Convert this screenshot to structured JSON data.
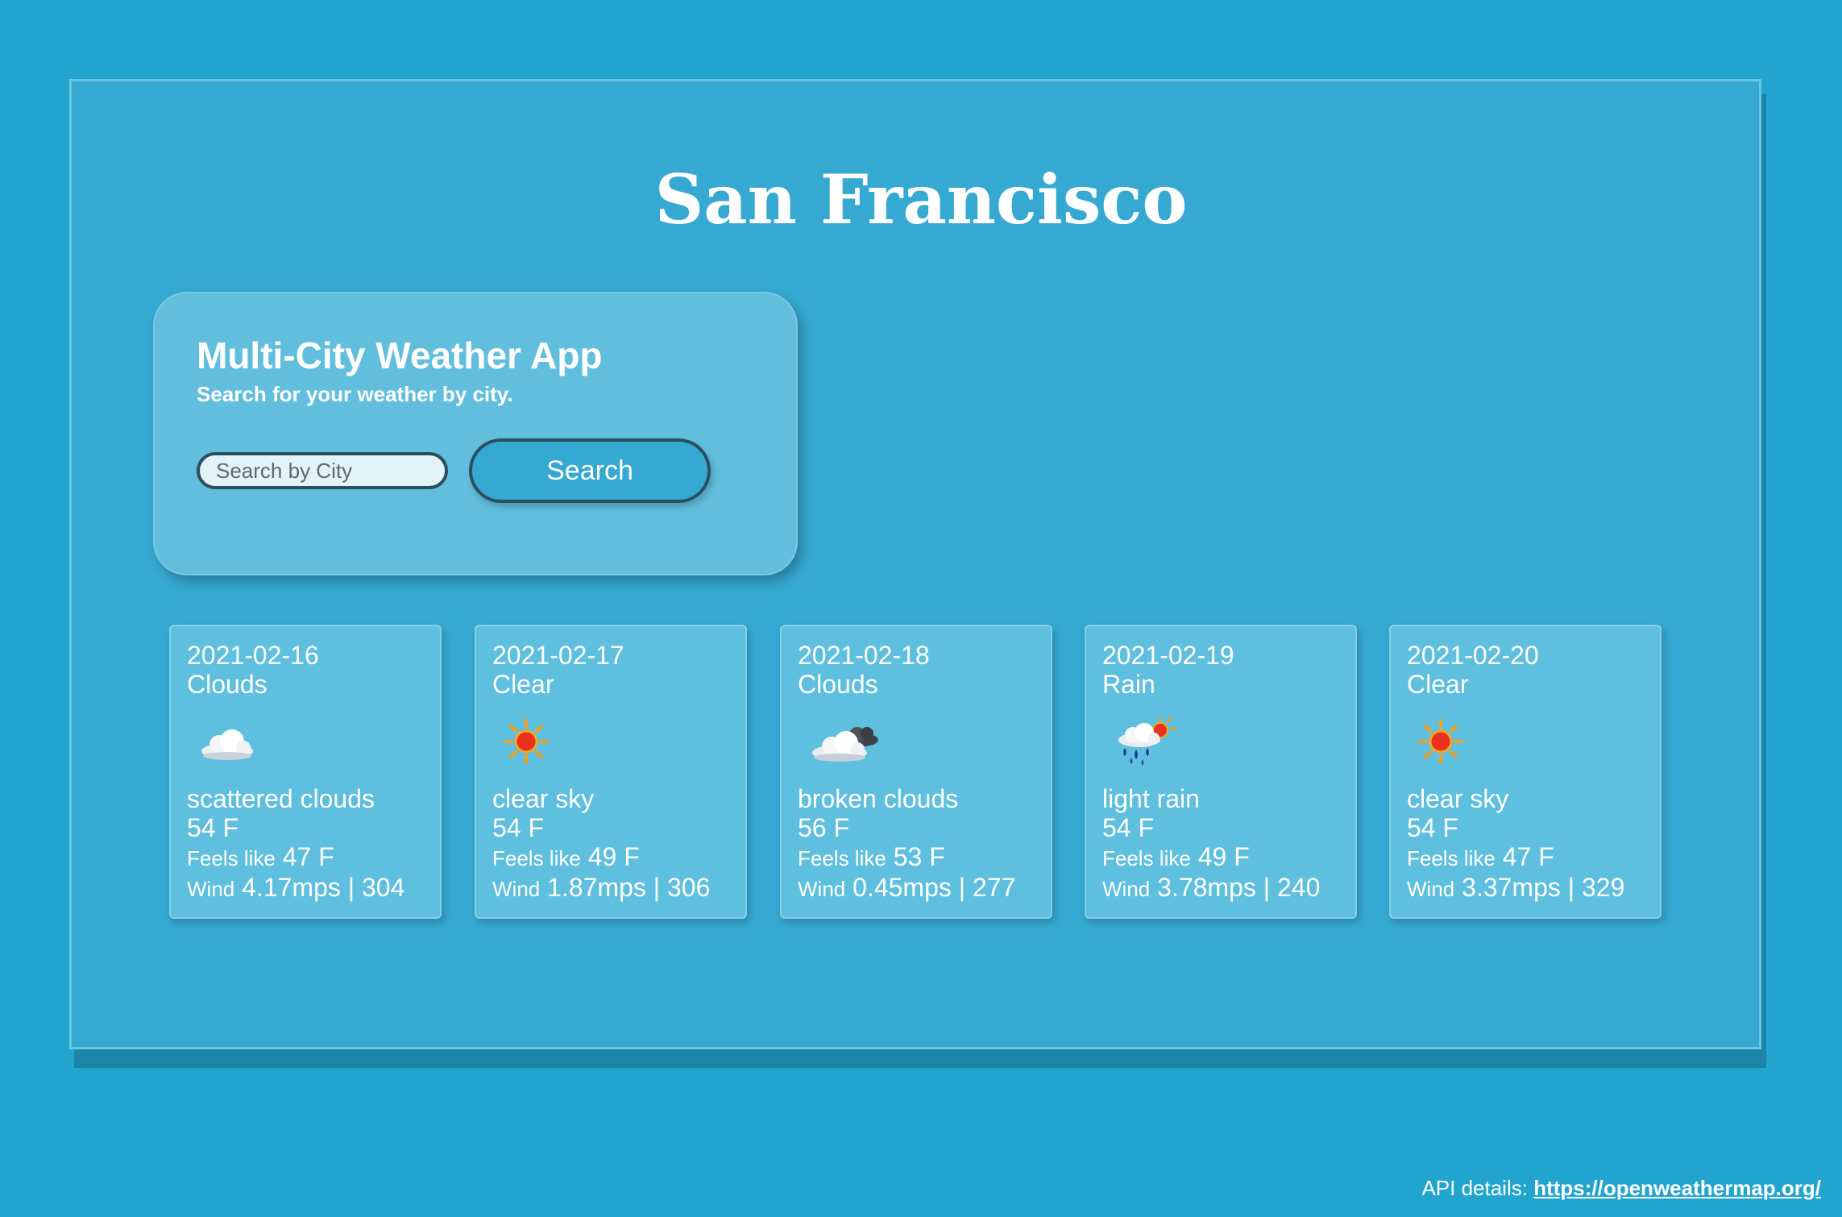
{
  "header": {
    "city": "San Francisco"
  },
  "search_panel": {
    "title": "Multi-City Weather App",
    "subtitle": "Search for your weather by city.",
    "input_placeholder": "Search by City",
    "button_label": "Search"
  },
  "forecast": [
    {
      "date": "2021-02-16",
      "condition": "Clouds",
      "icon": "scattered-clouds-icon",
      "description": "scattered clouds",
      "temp": "54 F",
      "feels_label": "Feels like",
      "feels_value": "47 F",
      "wind_label": "Wind",
      "wind_value": "4.17mps | 304"
    },
    {
      "date": "2021-02-17",
      "condition": "Clear",
      "icon": "clear-sky-icon",
      "description": "clear sky",
      "temp": "54 F",
      "feels_label": "Feels like",
      "feels_value": "49 F",
      "wind_label": "Wind",
      "wind_value": "1.87mps | 306"
    },
    {
      "date": "2021-02-18",
      "condition": "Clouds",
      "icon": "broken-clouds-icon",
      "description": "broken clouds",
      "temp": "56 F",
      "feels_label": "Feels like",
      "feels_value": "53 F",
      "wind_label": "Wind",
      "wind_value": "0.45mps | 277"
    },
    {
      "date": "2021-02-19",
      "condition": "Rain",
      "icon": "light-rain-icon",
      "description": "light rain",
      "temp": "54 F",
      "feels_label": "Feels like",
      "feels_value": "49 F",
      "wind_label": "Wind",
      "wind_value": "3.78mps | 240"
    },
    {
      "date": "2021-02-20",
      "condition": "Clear",
      "icon": "clear-sky-icon",
      "description": "clear sky",
      "temp": "54 F",
      "feels_label": "Feels like",
      "feels_value": "47 F",
      "wind_label": "Wind",
      "wind_value": "3.37mps | 329"
    }
  ],
  "footer": {
    "label": "API details:",
    "link_text": "https://openweathermap.org/"
  },
  "colors": {
    "page_background": "#21a5ce",
    "frame_background": "#36a9d2",
    "card_background": "#5fbfde",
    "input_border": "#2c4f5e",
    "sun": "#e8321e"
  }
}
